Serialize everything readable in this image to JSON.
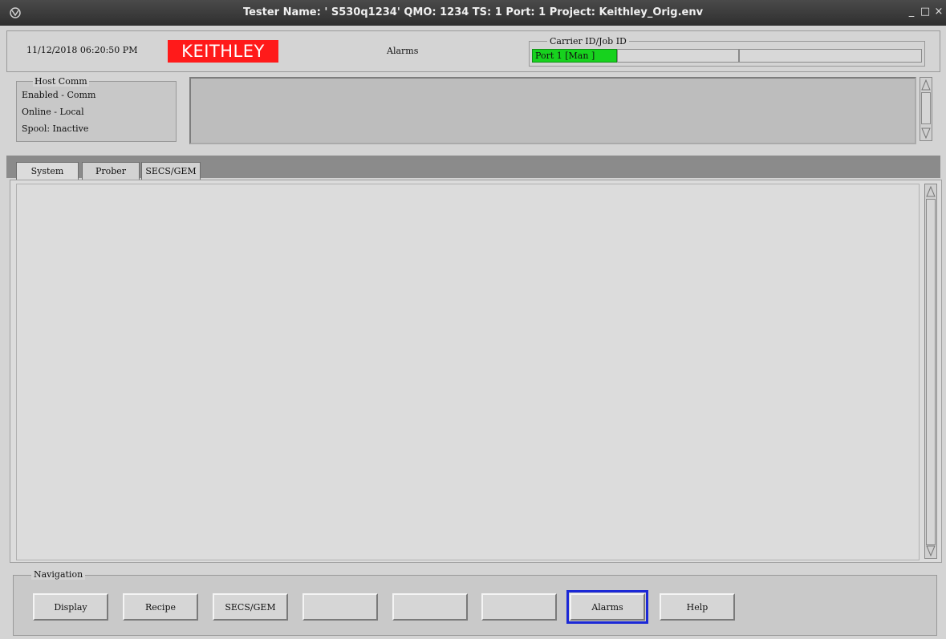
{
  "window": {
    "title": "Tester Name: ' S530q1234' QMO: 1234 TS: 1 Port: 1 Project: Keithley_Orig.env",
    "minimize_glyph": "_",
    "maximize_glyph": "□",
    "close_glyph": "×"
  },
  "header": {
    "datetime": "11/12/2018 06:20:50 PM",
    "logo_text": "KEITHLEY",
    "status": "Alarms",
    "carrier": {
      "legend": "Carrier ID/Job ID",
      "port_status": "Port 1 [Man ]"
    }
  },
  "host_comm": {
    "legend": "Host Comm",
    "lines": [
      "Enabled - Comm",
      "Online - Local",
      "Spool: Inactive"
    ]
  },
  "tabs": [
    {
      "label": "System",
      "active": true
    },
    {
      "label": "Prober",
      "active": false
    },
    {
      "label": "SECS/GEM",
      "active": false
    }
  ],
  "navigation": {
    "legend": "Navigation",
    "buttons": [
      {
        "label": "Display"
      },
      {
        "label": "Recipe"
      },
      {
        "label": "SECS/GEM"
      },
      {
        "label": ""
      },
      {
        "label": ""
      },
      {
        "label": ""
      },
      {
        "label": "Alarms",
        "focused": true
      },
      {
        "label": "Help"
      }
    ]
  },
  "colors": {
    "logo_bg": "#ff1a1a",
    "port_active": "#17d21e",
    "focus_ring": "#1b28d6"
  }
}
